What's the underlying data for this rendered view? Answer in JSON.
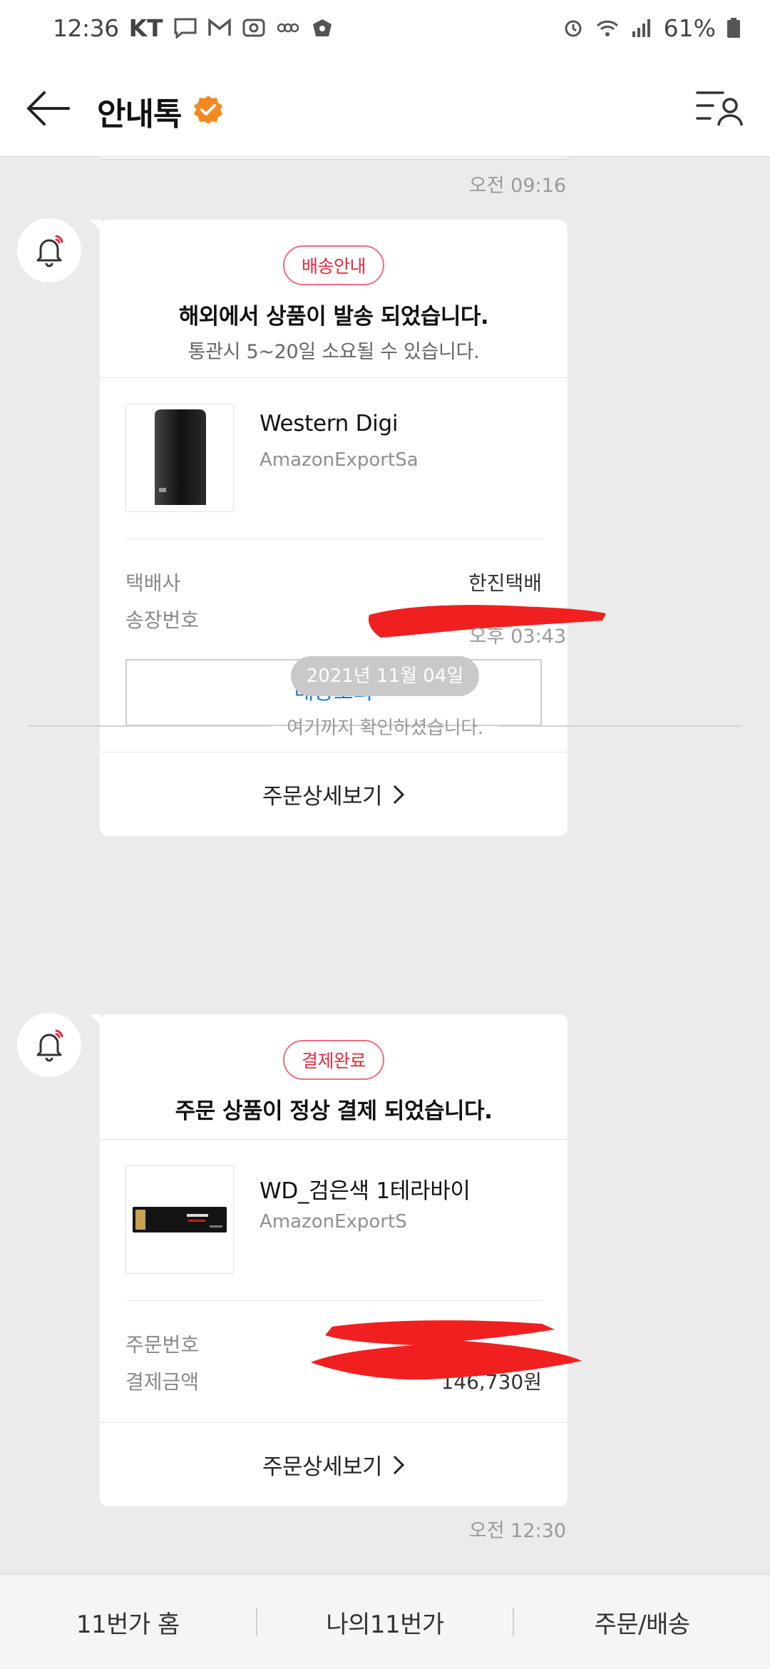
{
  "status_bar": {
    "time": "12:36",
    "carrier": "KT",
    "battery": "61%"
  },
  "header": {
    "title": "안내톡"
  },
  "messages": {
    "prev_time": "오전 09:16",
    "shipping": {
      "badge": "배송안내",
      "title": "해외에서 상품이 발송 되었습니다.",
      "subtitle": "통관시 5~20일 소요될 수 있습니다.",
      "product_name": "Western Digi",
      "seller": "AmazonExportSa",
      "courier_label": "택배사",
      "courier_value": "한진택배",
      "tracking_label": "송장번호",
      "track_button": "배송조회",
      "detail_link": "주문상세보기",
      "time": "오후 03:43"
    },
    "date_chip": "2021년 11월 04일",
    "read_divider": "여기까지 확인하셨습니다.",
    "payment": {
      "badge": "결제완료",
      "title": "주문 상품이 정상 결제 되었습니다.",
      "product_name": "WD_검은색 1테라바이",
      "seller": "AmazonExportS",
      "order_label": "주문번호",
      "amount_label": "결제금액",
      "amount_value": "146,730원",
      "detail_link": "주문상세보기",
      "time": "오전 12:30"
    }
  },
  "bottom_nav": {
    "home": "11번가 홈",
    "my": "나의11번가",
    "orders": "주문/배송"
  },
  "colors": {
    "accent_red": "#e8293e",
    "link_blue": "#1a7dd6",
    "verified_orange": "#f5891f",
    "redaction_red": "#f02020"
  }
}
